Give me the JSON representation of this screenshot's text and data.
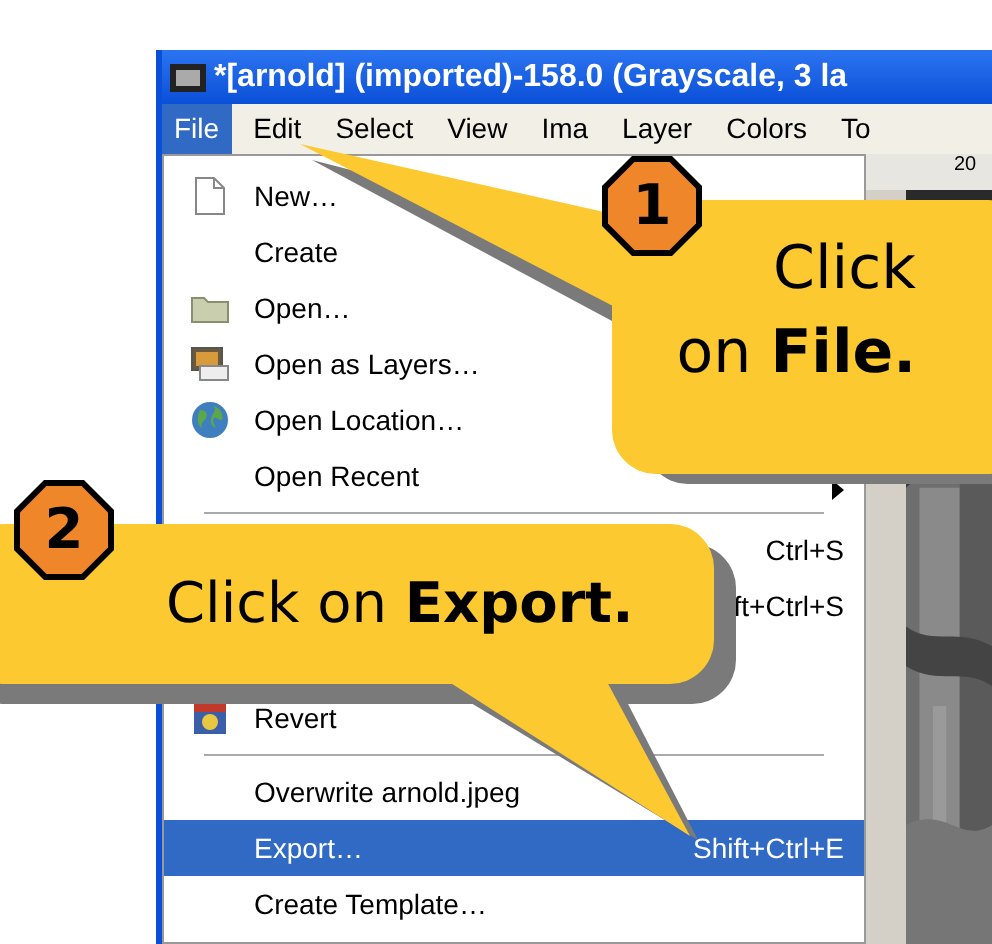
{
  "window": {
    "title": "*[arnold] (imported)-158.0 (Grayscale, 3 la"
  },
  "menubar": [
    {
      "label": "File",
      "selected": true
    },
    {
      "label": "Edit",
      "selected": false
    },
    {
      "label": "Select",
      "selected": false
    },
    {
      "label": "View",
      "selected": false
    },
    {
      "label": "Ima",
      "selected": false
    },
    {
      "label": "Layer",
      "selected": false
    },
    {
      "label": "Colors",
      "selected": false
    },
    {
      "label": "To",
      "selected": false
    }
  ],
  "file_menu": [
    {
      "kind": "item",
      "label": "New…",
      "selected": false
    },
    {
      "kind": "item",
      "label": "Create",
      "selected": false
    },
    {
      "kind": "item",
      "label": "Open…",
      "selected": false
    },
    {
      "kind": "item",
      "label": "Open as Layers…",
      "selected": false
    },
    {
      "kind": "item",
      "label": "Open Location…",
      "selected": false
    },
    {
      "kind": "submenu",
      "label": "Open Recent",
      "selected": false
    },
    {
      "kind": "separator"
    },
    {
      "kind": "item",
      "shortcut": "Ctrl+S",
      "selected": false
    },
    {
      "kind": "item",
      "shortcut": "ft+Ctrl+S",
      "selected": false
    },
    {
      "kind": "item",
      "selected": false
    },
    {
      "kind": "item",
      "label": "Revert",
      "selected": false
    },
    {
      "kind": "separator"
    },
    {
      "kind": "item",
      "label": "Overwrite arnold.jpeg",
      "selected": false
    },
    {
      "kind": "item",
      "label": "Export…",
      "shortcut": "Shift+Ctrl+E",
      "selected": true
    },
    {
      "kind": "item",
      "label": "Create Template…",
      "selected": false
    }
  ],
  "ruler": {
    "label": "20"
  },
  "callouts": [
    {
      "step": "1",
      "text": "Click\non **File.**"
    },
    {
      "step": "2",
      "text": "Click on **Export.**"
    }
  ]
}
